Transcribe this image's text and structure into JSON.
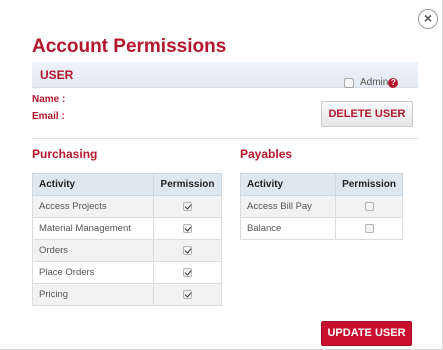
{
  "modal": {
    "close_symbol": "×",
    "title": "Account Permissions"
  },
  "user": {
    "section_label": "USER",
    "admin_label": "Admin",
    "help_symbol": "?",
    "name_label": "Name :",
    "email_label": "Email :",
    "delete_button": "DELETE USER"
  },
  "purchasing": {
    "title": "Purchasing",
    "col_activity": "Activity",
    "col_permission": "Permission",
    "rows": [
      {
        "activity": "Access Projects",
        "checked": true
      },
      {
        "activity": "Material Management",
        "checked": true
      },
      {
        "activity": "Orders",
        "checked": true
      },
      {
        "activity": "Place Orders",
        "checked": true
      },
      {
        "activity": "Pricing",
        "checked": true
      }
    ]
  },
  "payables": {
    "title": "Payables",
    "col_activity": "Activity",
    "col_permission": "Permission",
    "rows": [
      {
        "activity": "Access Bill Pay",
        "checked": false
      },
      {
        "activity": "Balance",
        "checked": false
      }
    ]
  },
  "footer": {
    "update_button": "UPDATE USER"
  },
  "colors": {
    "accent": "#b3162d",
    "primary_button": "#c8102e",
    "header_bg": "#dde7f0"
  }
}
